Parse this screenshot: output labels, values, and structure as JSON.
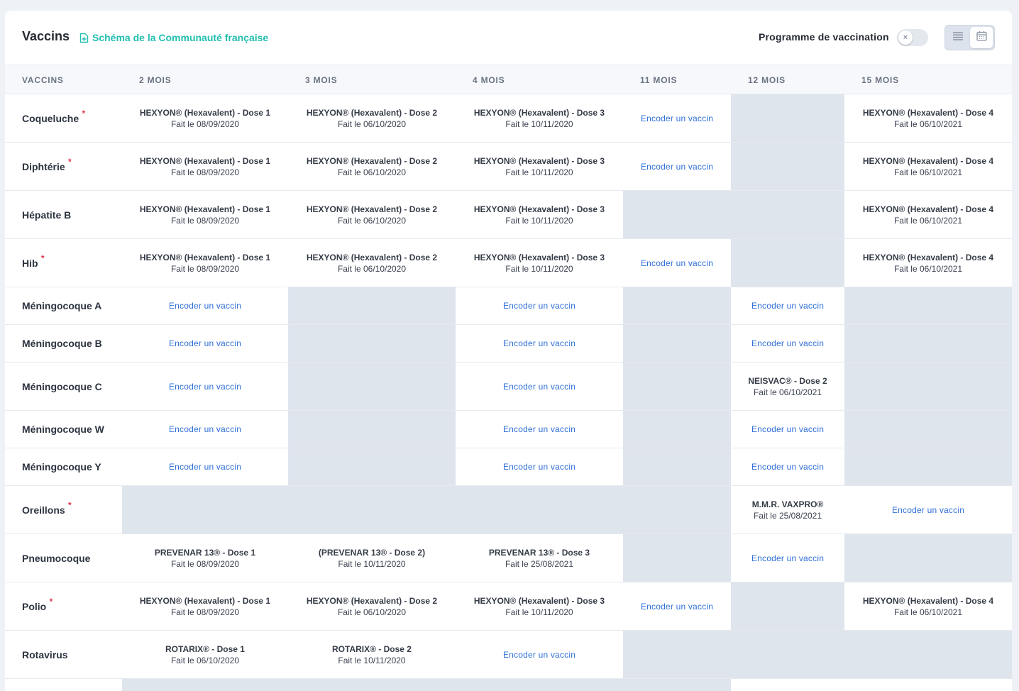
{
  "header": {
    "title": "Vaccins",
    "schema_link": "Schéma de la Communauté française",
    "program_label": "Programme de vaccination",
    "toggle_symbol": "×"
  },
  "columns": [
    "VACCINS",
    "2 MOIS",
    "3 MOIS",
    "4 MOIS",
    "11 MOIS",
    "12 MOIS",
    "15 MOIS"
  ],
  "action_label": "Encoder un vaccin",
  "rows": [
    {
      "name": "Coqueluche",
      "required": true,
      "cells": [
        {
          "type": "dose",
          "name": "HEXYON® (Hexavalent) - Dose 1",
          "date": "Fait le 08/09/2020"
        },
        {
          "type": "dose",
          "name": "HEXYON® (Hexavalent) - Dose 2",
          "date": "Fait le 06/10/2020"
        },
        {
          "type": "dose",
          "name": "HEXYON® (Hexavalent) - Dose 3",
          "date": "Fait le 10/11/2020"
        },
        {
          "type": "action"
        },
        {
          "type": "na"
        },
        {
          "type": "dose",
          "name": "HEXYON® (Hexavalent) - Dose 4",
          "date": "Fait le 06/10/2021"
        }
      ]
    },
    {
      "name": "Diphtérie",
      "required": true,
      "cells": [
        {
          "type": "dose",
          "name": "HEXYON® (Hexavalent) - Dose 1",
          "date": "Fait le 08/09/2020"
        },
        {
          "type": "dose",
          "name": "HEXYON® (Hexavalent) - Dose 2",
          "date": "Fait le 06/10/2020"
        },
        {
          "type": "dose",
          "name": "HEXYON® (Hexavalent) - Dose 3",
          "date": "Fait le 10/11/2020"
        },
        {
          "type": "action"
        },
        {
          "type": "na"
        },
        {
          "type": "dose",
          "name": "HEXYON® (Hexavalent) - Dose 4",
          "date": "Fait le 06/10/2021"
        }
      ]
    },
    {
      "name": "Hépatite B",
      "required": false,
      "cells": [
        {
          "type": "dose",
          "name": "HEXYON® (Hexavalent) - Dose 1",
          "date": "Fait le 08/09/2020"
        },
        {
          "type": "dose",
          "name": "HEXYON® (Hexavalent) - Dose 2",
          "date": "Fait le 06/10/2020"
        },
        {
          "type": "dose",
          "name": "HEXYON® (Hexavalent) - Dose 3",
          "date": "Fait le 10/11/2020"
        },
        {
          "type": "na"
        },
        {
          "type": "na"
        },
        {
          "type": "dose",
          "name": "HEXYON® (Hexavalent) - Dose 4",
          "date": "Fait le 06/10/2021"
        }
      ]
    },
    {
      "name": "Hib",
      "required": true,
      "cells": [
        {
          "type": "dose",
          "name": "HEXYON® (Hexavalent) - Dose 1",
          "date": "Fait le 08/09/2020"
        },
        {
          "type": "dose",
          "name": "HEXYON® (Hexavalent) - Dose 2",
          "date": "Fait le 06/10/2020"
        },
        {
          "type": "dose",
          "name": "HEXYON® (Hexavalent) - Dose 3",
          "date": "Fait le 10/11/2020"
        },
        {
          "type": "action"
        },
        {
          "type": "na"
        },
        {
          "type": "dose",
          "name": "HEXYON® (Hexavalent) - Dose 4",
          "date": "Fait le 06/10/2021"
        }
      ]
    },
    {
      "name": "Méningocoque A",
      "required": false,
      "cells": [
        {
          "type": "action"
        },
        {
          "type": "na"
        },
        {
          "type": "action"
        },
        {
          "type": "na"
        },
        {
          "type": "action"
        },
        {
          "type": "na"
        }
      ]
    },
    {
      "name": "Méningocoque B",
      "required": false,
      "cells": [
        {
          "type": "action"
        },
        {
          "type": "na"
        },
        {
          "type": "action"
        },
        {
          "type": "na"
        },
        {
          "type": "action"
        },
        {
          "type": "na"
        }
      ]
    },
    {
      "name": "Méningocoque C",
      "required": false,
      "cells": [
        {
          "type": "action"
        },
        {
          "type": "na"
        },
        {
          "type": "action"
        },
        {
          "type": "na"
        },
        {
          "type": "dose",
          "name": "NEISVAC® - Dose 2",
          "date": "Fait le 06/10/2021"
        },
        {
          "type": "na"
        }
      ]
    },
    {
      "name": "Méningocoque W",
      "required": false,
      "cells": [
        {
          "type": "action"
        },
        {
          "type": "na"
        },
        {
          "type": "action"
        },
        {
          "type": "na"
        },
        {
          "type": "action"
        },
        {
          "type": "na"
        }
      ]
    },
    {
      "name": "Méningocoque Y",
      "required": false,
      "cells": [
        {
          "type": "action"
        },
        {
          "type": "na"
        },
        {
          "type": "action"
        },
        {
          "type": "na"
        },
        {
          "type": "action"
        },
        {
          "type": "na"
        }
      ]
    },
    {
      "name": "Oreillons",
      "required": true,
      "cells": [
        {
          "type": "na"
        },
        {
          "type": "na"
        },
        {
          "type": "na"
        },
        {
          "type": "na"
        },
        {
          "type": "dose",
          "name": "M.M.R. VAXPRO®",
          "date": "Fait le 25/08/2021"
        },
        {
          "type": "action"
        }
      ]
    },
    {
      "name": "Pneumocoque",
      "required": false,
      "cells": [
        {
          "type": "dose",
          "name": "PREVENAR 13® - Dose 1",
          "date": "Fait le 08/09/2020"
        },
        {
          "type": "dose",
          "name": "(PREVENAR 13® - Dose 2)",
          "date": "Fait le 10/11/2020"
        },
        {
          "type": "dose",
          "name": "PREVENAR 13® - Dose 3",
          "date": "Fait le 25/08/2021"
        },
        {
          "type": "na"
        },
        {
          "type": "action"
        },
        {
          "type": "na"
        }
      ]
    },
    {
      "name": "Polio",
      "required": true,
      "cells": [
        {
          "type": "dose",
          "name": "HEXYON® (Hexavalent) - Dose 1",
          "date": "Fait le 08/09/2020"
        },
        {
          "type": "dose",
          "name": "HEXYON® (Hexavalent) - Dose 2",
          "date": "Fait le 06/10/2020"
        },
        {
          "type": "dose",
          "name": "HEXYON® (Hexavalent) - Dose 3",
          "date": "Fait le 10/11/2020"
        },
        {
          "type": "action"
        },
        {
          "type": "na"
        },
        {
          "type": "dose",
          "name": "HEXYON® (Hexavalent) - Dose 4",
          "date": "Fait le 06/10/2021"
        }
      ]
    },
    {
      "name": "Rotavirus",
      "required": false,
      "cells": [
        {
          "type": "dose",
          "name": "ROTARIX® - Dose 1",
          "date": "Fait le 06/10/2020"
        },
        {
          "type": "dose",
          "name": "ROTARIX® - Dose 2",
          "date": "Fait le 10/11/2020"
        },
        {
          "type": "action"
        },
        {
          "type": "na"
        },
        {
          "type": "na"
        },
        {
          "type": "na"
        }
      ]
    },
    {
      "name": "",
      "required": false,
      "cells": [
        {
          "type": "na"
        },
        {
          "type": "na"
        },
        {
          "type": "na"
        },
        {
          "type": "na"
        },
        {
          "type": "blank"
        },
        {
          "type": "blank"
        }
      ]
    }
  ]
}
